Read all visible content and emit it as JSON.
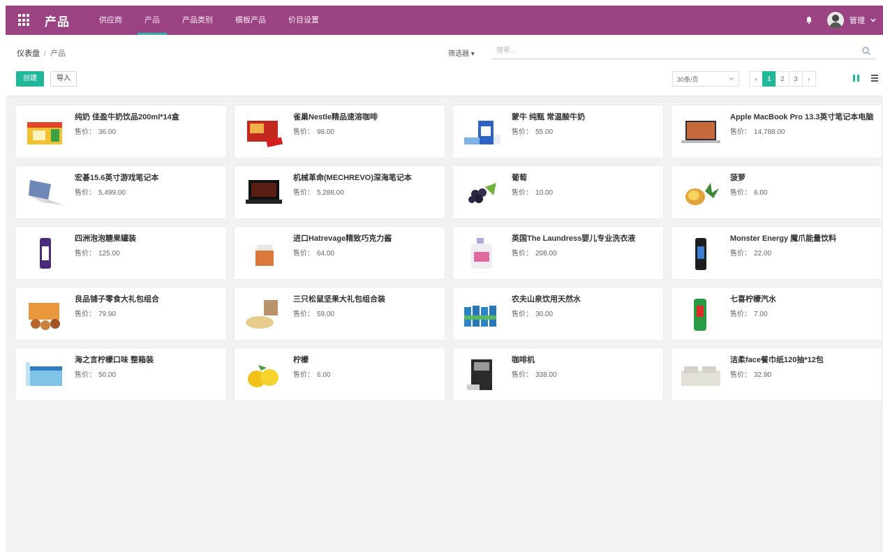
{
  "app": {
    "brand": "产品"
  },
  "nav": {
    "items": [
      {
        "label": "供应商",
        "active": false
      },
      {
        "label": "产品",
        "active": true
      },
      {
        "label": "产品类别",
        "active": false
      },
      {
        "label": "模板产品",
        "active": false
      },
      {
        "label": "价目设置",
        "active": false
      }
    ],
    "user_name": "管理"
  },
  "breadcrumb": {
    "root": "仪表盘",
    "current": "产品"
  },
  "filters": {
    "label": "筛选器 ▾"
  },
  "search": {
    "placeholder": "搜索..."
  },
  "actions": {
    "create": "创建",
    "import": "导入"
  },
  "pager": {
    "per_page": "30条/页",
    "pages": [
      "‹",
      "1",
      "2",
      "3",
      "›"
    ],
    "active_page": "1"
  },
  "colors": {
    "topbar": "#9b4283",
    "accent": "#21b799"
  },
  "price_label": "售价：",
  "products": [
    {
      "name": "纯奶 佳盈牛奶饮品200ml*14盒",
      "price": "36.00",
      "icon": "milk-box-image"
    },
    {
      "name": "雀巢Nestle精品速溶咖啡",
      "price": "98.00",
      "icon": "coffee-box-image"
    },
    {
      "name": "蒙牛 纯甄 常温酸牛奶",
      "price": "55.00",
      "icon": "yogurt-pack-image"
    },
    {
      "name": "Apple MacBook Pro 13.3英寸笔记本电脑",
      "price": "14,788.00",
      "icon": "macbook-image"
    },
    {
      "name": "宏碁15.6英寸游戏笔记本",
      "price": "5,499.00",
      "icon": "laptop-silver-image"
    },
    {
      "name": "机械革命(MECHREVO)深海笔记本",
      "price": "5,288.00",
      "icon": "laptop-black-image"
    },
    {
      "name": "葡萄",
      "price": "10.00",
      "icon": "grapes-image"
    },
    {
      "name": "菠萝",
      "price": "6.00",
      "icon": "pineapple-image"
    },
    {
      "name": "四洲泡泡糖果罐装",
      "price": "125.00",
      "icon": "purple-can-image"
    },
    {
      "name": "进口Hatrevage精致巧克力酱",
      "price": "64.00",
      "icon": "jam-jar-image"
    },
    {
      "name": "英国The Laundress婴儿专业洗衣液",
      "price": "208.00",
      "icon": "detergent-bottle-image"
    },
    {
      "name": "Monster Energy 魔爪能量饮料",
      "price": "22.00",
      "icon": "energy-drink-image"
    },
    {
      "name": "良品铺子零食大礼包组合",
      "price": "79.90",
      "icon": "snack-pack-image"
    },
    {
      "name": "三只松鼠坚果大礼包组合装",
      "price": "59.00",
      "icon": "nut-box-image"
    },
    {
      "name": "农夫山泉饮用天然水",
      "price": "30.00",
      "icon": "water-bottles-image"
    },
    {
      "name": "七喜柠檬汽水",
      "price": "7.00",
      "icon": "soda-can-image"
    },
    {
      "name": "海之言柠檬口味 整箱装",
      "price": "50.00",
      "icon": "water-box-image"
    },
    {
      "name": "柠檬",
      "price": "6.00",
      "icon": "lemons-image"
    },
    {
      "name": "咖啡机",
      "price": "338.00",
      "icon": "coffee-machine-image"
    },
    {
      "name": "洁柔face餐巾纸120抽*12包",
      "price": "32.90",
      "icon": "tissue-pack-image"
    }
  ]
}
